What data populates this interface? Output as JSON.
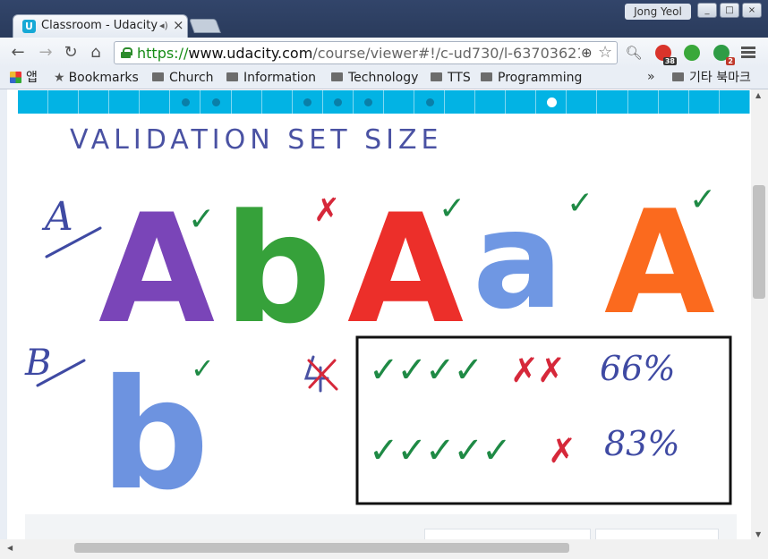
{
  "browser": {
    "tab_title": "Classroom - Udacity",
    "tab_audio_icon": "speaker-icon",
    "tab_close_icon": "close-icon",
    "user_name": "Jong Yeol",
    "url_scheme": "https://",
    "url_host": "www.udacity.com",
    "url_path": "/course/viewer#!/c-ud730/l-6370362152/m-",
    "extensions": [
      {
        "name": "extension-red-icon",
        "badge": "38",
        "color": "#d9342b"
      },
      {
        "name": "extension-green-balloon-icon",
        "badge": "",
        "color": "#3aa83a"
      },
      {
        "name": "extension-green-counter-icon",
        "badge": "2",
        "color": "#2e9c45"
      }
    ]
  },
  "bookmarks": {
    "apps_label": "앱",
    "items": [
      "Bookmarks",
      "Church",
      "Information",
      "Technology",
      "TTS",
      "Programming"
    ],
    "more_label": "»",
    "other_label": "기타 북마크"
  },
  "lesson": {
    "progress_segments": 24,
    "marked_segments": [
      5,
      6,
      9,
      10,
      11,
      13
    ],
    "current_segment": 17,
    "accent": "#02b3e4"
  },
  "whiteboard": {
    "title": "VALIDATION SET SIZE",
    "label_a": "A",
    "label_b": "B",
    "letters_a": [
      {
        "char": "A",
        "color": "#7a45b8",
        "mark": "✓",
        "mark_color": "#1f8a45"
      },
      {
        "char": "b",
        "color": "#36a13a",
        "mark": "✗",
        "mark_color": "#d6283a"
      },
      {
        "char": "A",
        "color": "#ec2f2a",
        "mark": "✓",
        "mark_color": "#1f8a45"
      },
      {
        "char": "a",
        "color": "#6f97e3",
        "mark": "✓",
        "mark_color": "#1f8a45"
      },
      {
        "char": "A",
        "color": "#fb6a1e",
        "mark": "✓",
        "mark_color": "#1f8a45"
      }
    ],
    "letter_b": {
      "char": "b",
      "color": "#6d93e0",
      "mark": "✓",
      "mark_color": "#1f8a45"
    },
    "result_row_1": {
      "marks": "✓✓✓✓",
      "wrong": "✗✗",
      "percent": "66%"
    },
    "result_row_2": {
      "marks": "✓✓✓✓✓",
      "wrong": "✗",
      "percent": "83%"
    }
  }
}
